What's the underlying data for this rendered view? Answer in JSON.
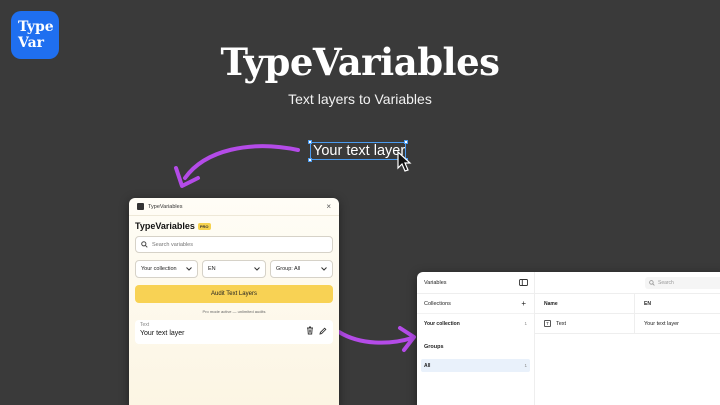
{
  "brand": {
    "logo_line1": "Type",
    "logo_line2": "Var",
    "title": "TypeVariables",
    "subtitle": "Text layers to Variables"
  },
  "canvas": {
    "sample_text": "Your text layer"
  },
  "plugin": {
    "window_title": "TypeVariables",
    "close_icon": "×",
    "name": "TypeVariables",
    "badge": "PRO",
    "search_placeholder": "Search variables",
    "collection_select": "Your collection",
    "language_select": "EN",
    "group_select": "Group: All",
    "audit_button": "Audit Text Layers",
    "note": "Pro mode active — unlimited audits",
    "layer": {
      "label": "Text",
      "value": "Your text layer"
    },
    "colors": {
      "accent": "#f8d254",
      "panel": "#fffdf6"
    }
  },
  "variables_panel": {
    "title": "Variables",
    "search_placeholder": "Search",
    "collections_header": "Collections",
    "add_icon": "+",
    "collection": {
      "label": "Your collection",
      "count": "1"
    },
    "groups_header": "Groups",
    "group": {
      "label": "All",
      "count": "1"
    },
    "columns": {
      "name": "Name",
      "mode": "EN"
    },
    "rows": [
      {
        "name": "Text",
        "value": "Your text layer"
      }
    ]
  },
  "colors": {
    "background": "#3a3a3a",
    "logo": "#1f6ff0",
    "arrow": "#b44be8",
    "selection": "#4a9bf0"
  }
}
